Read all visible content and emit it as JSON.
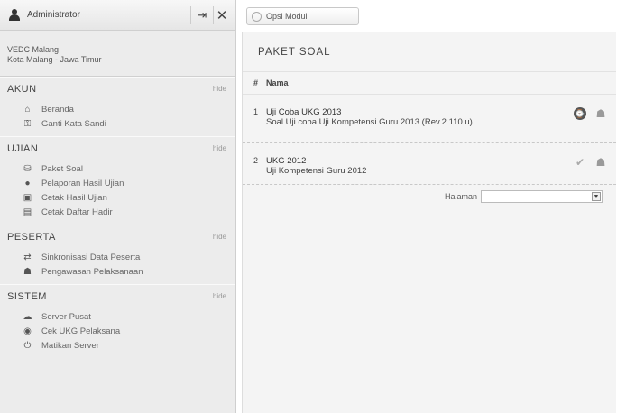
{
  "sidebar": {
    "user_name": "Administrator",
    "school_name": "VEDC Malang",
    "school_city": "Kota Malang - Jawa Timur",
    "toggle_label": "hide",
    "groups": [
      {
        "title": "AKUN",
        "items": [
          {
            "label": "Beranda",
            "icon": "home-icon"
          },
          {
            "label": "Ganti Kata Sandi",
            "icon": "key-icon"
          }
        ]
      },
      {
        "title": "UJIAN",
        "items": [
          {
            "label": "Paket Soal",
            "icon": "package-icon"
          },
          {
            "label": "Pelaporan Hasil Ujian",
            "icon": "globe-icon"
          },
          {
            "label": "Cetak Hasil Ujian",
            "icon": "print-icon"
          },
          {
            "label": "Cetak Daftar Hadir",
            "icon": "list-icon"
          }
        ]
      },
      {
        "title": "PESERTA",
        "items": [
          {
            "label": "Sinkronisasi Data Peserta",
            "icon": "sync-icon"
          },
          {
            "label": "Pengawasan Pelaksanaan",
            "icon": "monitor-icon"
          }
        ]
      },
      {
        "title": "SISTEM",
        "items": [
          {
            "label": "Server Pusat",
            "icon": "cloud-icon"
          },
          {
            "label": "Cek UKG Pelaksana",
            "icon": "check-circle-icon"
          },
          {
            "label": "Matikan Server",
            "icon": "power-icon"
          }
        ]
      }
    ]
  },
  "toolbar": {
    "opsi_modul_label": "Opsi Modul"
  },
  "panel": {
    "title": "PAKET SOAL",
    "col_number": "#",
    "col_name": "Nama",
    "rows": [
      {
        "no": "1",
        "title": "Uji Coba UKG 2013",
        "subtitle": "Soal Uji coba Uji Kompetensi Guru 2013 (Rev.2.110.u)"
      },
      {
        "no": "2",
        "title": "UKG 2012",
        "subtitle": "Uji Kompetensi Guru 2012"
      }
    ],
    "pager_label": "Halaman",
    "pager_value": ""
  },
  "colors": {
    "sidebar_bg": "#ececec",
    "panel_bg": "#f4f4f4",
    "accent": "#555555"
  }
}
